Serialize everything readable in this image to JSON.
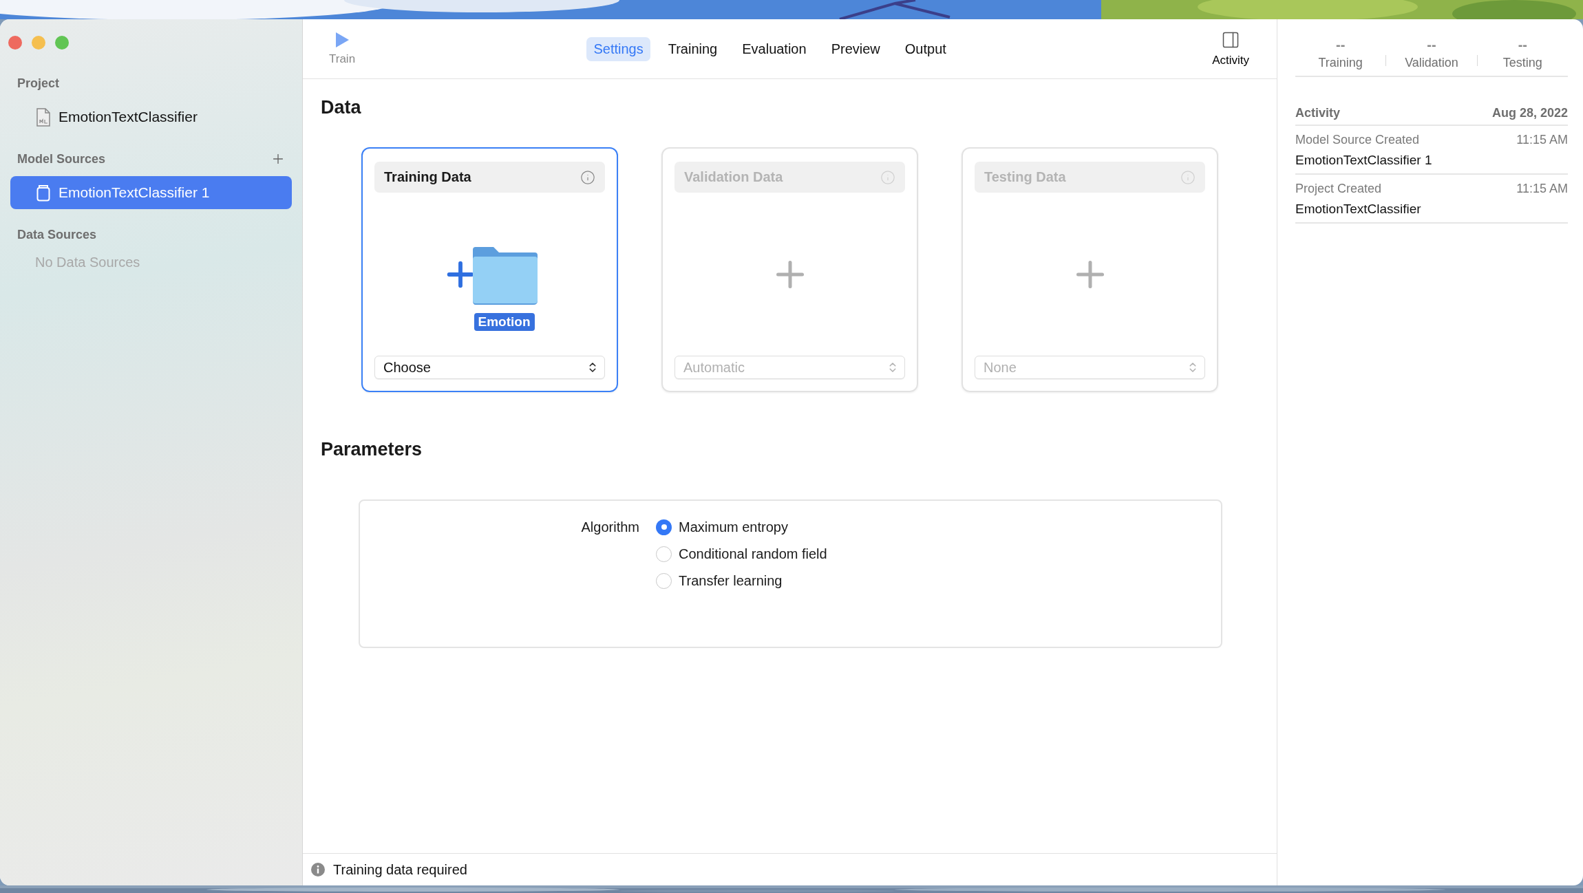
{
  "sidebar": {
    "sections": [
      {
        "title": "Project",
        "add_button": false,
        "items": [
          {
            "label": "EmotionTextClassifier",
            "kind": "project",
            "selected": false
          }
        ]
      },
      {
        "title": "Model Sources",
        "add_button": true,
        "items": [
          {
            "label": "EmotionTextClassifier 1",
            "kind": "model",
            "selected": true
          }
        ]
      },
      {
        "title": "Data Sources",
        "add_button": false,
        "empty_text": "No Data Sources"
      }
    ]
  },
  "toolbar": {
    "train": {
      "label": "Train"
    },
    "tabs": [
      {
        "label": "Settings",
        "selected": true
      },
      {
        "label": "Training",
        "selected": false
      },
      {
        "label": "Evaluation",
        "selected": false
      },
      {
        "label": "Preview",
        "selected": false
      },
      {
        "label": "Output",
        "selected": false
      }
    ],
    "activity": {
      "label": "Activity"
    }
  },
  "data": {
    "title": "Data",
    "cards": [
      {
        "title": "Training Data",
        "kind": "dropped",
        "file_label": "Emotion",
        "selected": true,
        "disabled": false,
        "popup": "Choose"
      },
      {
        "title": "Validation Data",
        "kind": "empty",
        "selected": false,
        "disabled": true,
        "popup": "Automatic"
      },
      {
        "title": "Testing Data",
        "kind": "empty",
        "selected": false,
        "disabled": true,
        "popup": "None"
      }
    ]
  },
  "parameters": {
    "title": "Parameters",
    "label": "Algorithm",
    "options": [
      {
        "label": "Maximum entropy",
        "selected": true
      },
      {
        "label": "Conditional random field",
        "selected": false
      },
      {
        "label": "Transfer learning",
        "selected": false
      }
    ]
  },
  "status_bar": {
    "message": "Training data required"
  },
  "inspector": {
    "metrics": [
      {
        "value": "--",
        "label": "Training"
      },
      {
        "value": "--",
        "label": "Validation"
      },
      {
        "value": "--",
        "label": "Testing"
      }
    ],
    "activity": {
      "title": "Activity",
      "date": "Aug 28, 2022",
      "entries": [
        {
          "event": "Model Source Created",
          "time": "11:15 AM",
          "name": "EmotionTextClassifier 1"
        },
        {
          "event": "Project Created",
          "time": "11:15 AM",
          "name": "EmotionTextClassifier"
        }
      ]
    }
  }
}
